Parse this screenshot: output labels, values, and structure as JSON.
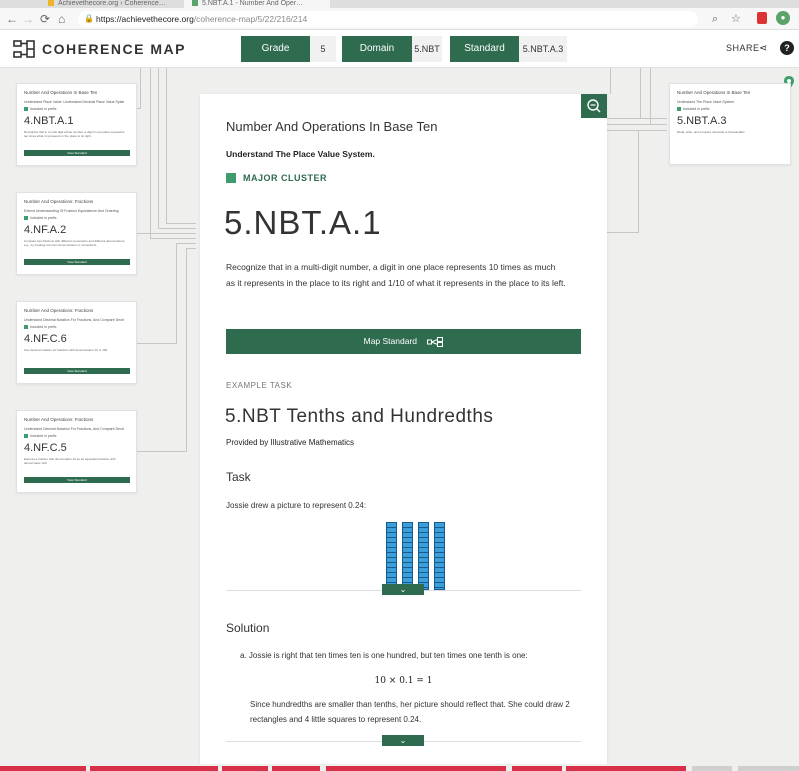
{
  "browser": {
    "tabs": [
      {
        "label": "Achievethecore.org › Coherence…"
      },
      {
        "label": "5.NBT.A.1 - Number And Oper…"
      }
    ],
    "url_host": "https://achievethecore.org",
    "url_path": "/coherence-map/5/22/216/214",
    "icons": [
      "back-icon",
      "forward-icon",
      "reload-icon",
      "home-icon",
      "lock-icon",
      "zoom-icon",
      "star-icon"
    ]
  },
  "header": {
    "logo_text": "COHERENCE MAP",
    "grade_label": "Grade",
    "grade_value": "5",
    "domain_label": "Domain",
    "domain_value": "5.NBT",
    "standard_label": "Standard",
    "standard_value": "5.NBT.A.3",
    "share_label": "SHARE",
    "help_label": "?"
  },
  "left_cards": [
    {
      "domain": "Number And Operations In Base Ten",
      "cluster": "Understand Place Value; Understand Decimal Place Value System",
      "tag": "Included in prefix",
      "code": "4.NBT.A.1",
      "desc": "Recognize that in a multi-digit whole number, a digit in one place represents ten times what it represents in the place to its right.",
      "button": "View Standard"
    },
    {
      "domain": "Number And Operations: Fractions",
      "cluster": "Extend Understanding Of Fraction Equivalence And Ordering",
      "tag": "Included in prefix",
      "code": "4.NF.A.2",
      "desc": "Compare two fractions with different numerators and different denominators, e.g., by creating common denominators or numerators.",
      "button": "View Standard"
    },
    {
      "domain": "Number And Operations: Fractions",
      "cluster": "Understand Decimal Notation For Fractions, And Compare Decimal Fractions",
      "tag": "Included in prefix",
      "code": "4.NF.C.6",
      "desc": "Use decimal notation for fractions with denominators 10 or 100.",
      "button": "View Standard"
    },
    {
      "domain": "Number And Operations: Fractions",
      "cluster": "Understand Decimal Notation For Fractions, And Compare Decimal Fractions",
      "tag": "Included in prefix",
      "code": "4.NF.C.5",
      "desc": "Express a fraction with denominator 10 as an equivalent fraction with denominator 100.",
      "button": "View Standard"
    }
  ],
  "right_card": {
    "domain": "Number And Operations In Base Ten",
    "cluster": "Understand The Place Value System.",
    "tag": "Included in prefix",
    "code": "5.NBT.A.3",
    "desc": "Read, write, and compare decimals to thousandths."
  },
  "main": {
    "domain_title": "Number And Operations In Base Ten",
    "cluster_title": "Understand The Place Value System.",
    "cluster_type": "MAJOR CLUSTER",
    "standard_code": "5.NBT.A.1",
    "standard_description": "Recognize that in a multi-digit number, a digit in one place represents 10 times as much as it represents in the place to its right and 1/10 of what it represents in the place to its left.",
    "map_button": "Map Standard",
    "example_label": "EXAMPLE TASK",
    "task_title": "5.NBT Tenths and Hundredths",
    "provided_by": "Provided by Illustrative Mathematics",
    "task_heading": "Task",
    "task_text": "Jossie drew a picture to represent 0.24:",
    "solution_heading": "Solution",
    "solution_a": "a. Jossie is right that ten times ten is one hundred, but ten times one tenth is one:",
    "solution_eq": "10 × 0.1 = 1",
    "solution_b": "Since hundredths are smaller than tenths, her picture should reflect that. She could draw 2 rectangles and 4 little squares to represent 0.24.",
    "expand_glyph": "⌄",
    "bar_count": 4
  },
  "colors": {
    "accent": "#2e6b4f",
    "major": "#3f9d6d",
    "bars": "#3aa0dc",
    "taskbar": "#d9304a"
  }
}
